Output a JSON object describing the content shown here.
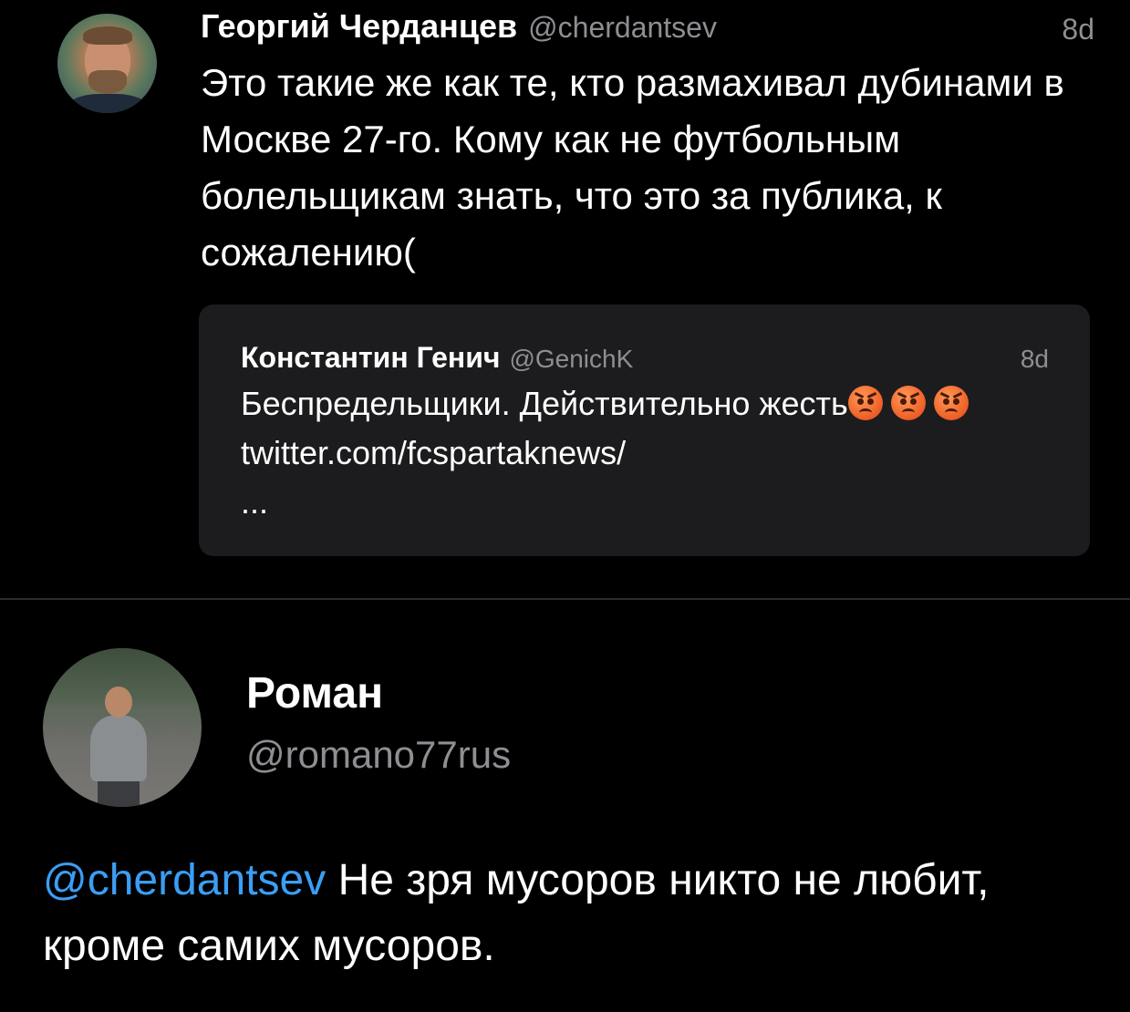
{
  "colors": {
    "background": "#000000",
    "text": "#ffffff",
    "secondary": "#8e8e93",
    "card": "#1c1c1e",
    "mention": "#3b9ef5"
  },
  "tweet": {
    "author_name": "Георгий Черданцев",
    "author_handle": "@cherdantsev",
    "time": "8d",
    "text": "Это такие же как те, кто размахивал дубинами в Москве 27-го. Кому как не футбольным болельщикам знать, что это за публика, к сожалению(",
    "avatar_icon": "profile-photo",
    "quote": {
      "author_name": "Константин Генич",
      "author_handle": "@GenichK",
      "time": "8d",
      "text_before": "Беспредельщики. Действительно жесть",
      "emojis": [
        "angry-face-icon",
        "angry-face-icon",
        "angry-face-icon"
      ],
      "link": "twitter.com/fcspartaknews/",
      "ellipsis": "..."
    }
  },
  "reply": {
    "user_name": "Роман",
    "user_handle": "@romano77rus",
    "mention": "@cherdantsev",
    "text": "Не зря мусоров никто не любит, кроме самих мусоров.",
    "avatar_icon": "profile-photo"
  }
}
